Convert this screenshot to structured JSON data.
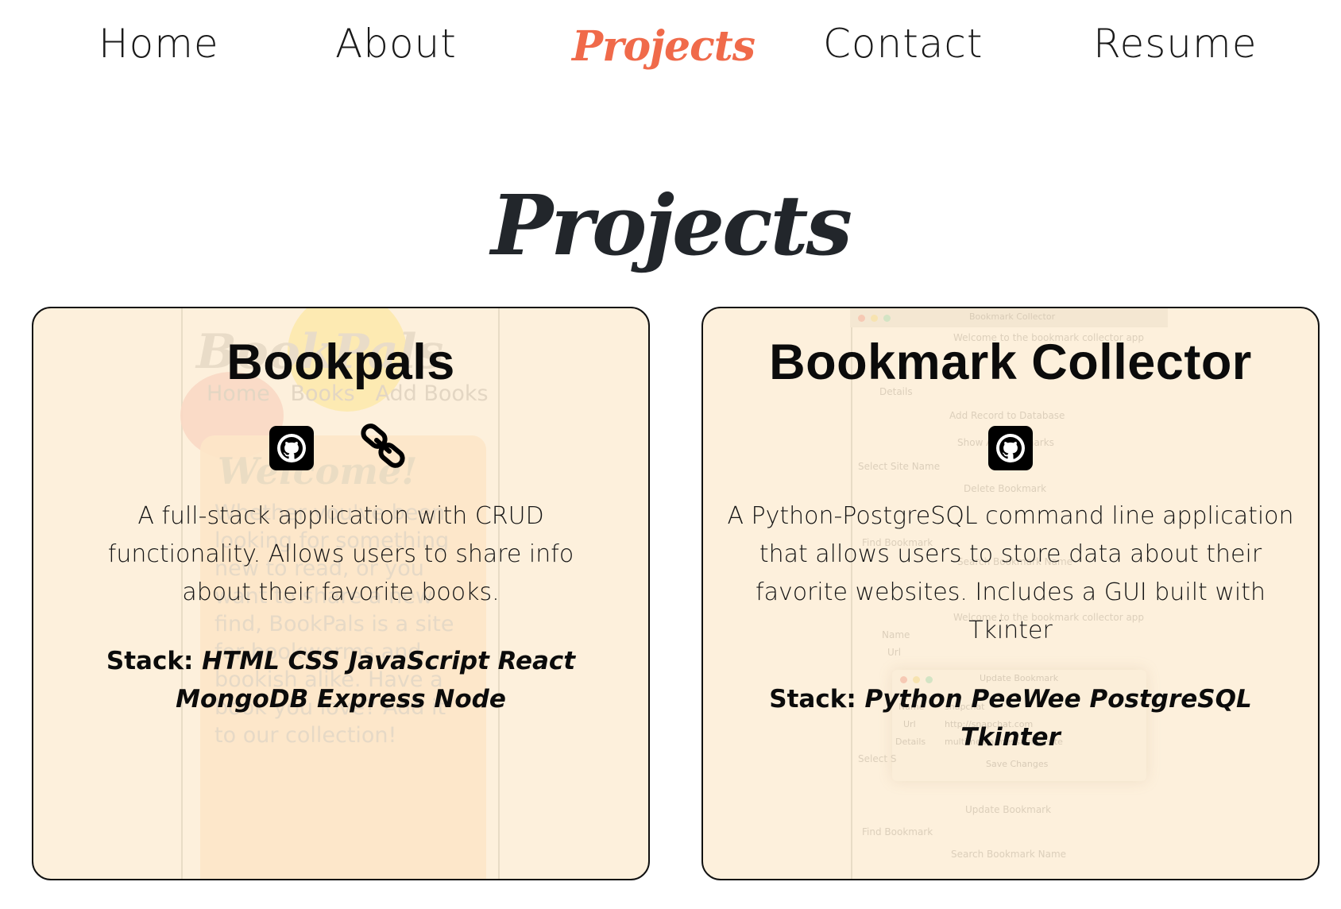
{
  "nav": {
    "items": [
      "Home",
      "About",
      "Projects",
      "Contact",
      "Resume"
    ],
    "active": "Projects",
    "active_color": "#f06a4a"
  },
  "page_title": "Projects",
  "projects": [
    {
      "title": "Bookpals",
      "links": [
        "github-icon",
        "link-icon"
      ],
      "description": "A full-stack application with CRUD functionality. Allows users to share info about their favorite books.",
      "stack_label": "Stack:",
      "stack": "HTML CSS JavaScript React MongoDB Express Node",
      "background_text": {
        "logo": "BookPals",
        "nav": "Home   Books   Add Books",
        "welcome": "Welcome!",
        "body": "Whether you've been looking for something new to read, or you want to share a new find, BookPals is a site for bookworms and bookish alike. Have a book you love? Add it to our collection!"
      }
    },
    {
      "title": "Bookmark Collector",
      "links": [
        "github-icon"
      ],
      "description": "A Python-PostgreSQL command line application that allows users to store data about their favorite websites. Includes a GUI built with Tkinter",
      "stack_label": "Stack:",
      "stack": "Python PeeWee PostgreSQL Tkinter",
      "background_text": {
        "window_title": "Bookmark Collector",
        "welcome": "Welcome to the bookmark collector app",
        "details": "Details",
        "add": "Add Record to Database",
        "show": "Show All Bookmarks",
        "select": "Select Site Name",
        "delete": "Delete Bookmark",
        "find": "Find Bookmark",
        "search": "Search Bookmark Name",
        "welcome2": "Welcome to the bookmark collector app",
        "name": "Name",
        "url": "Url",
        "update": "Update Bookmark",
        "name_value": "snapchat",
        "url_value": "http://snapchat.com",
        "details_value": "multimedia messaging site",
        "save": "Save Changes",
        "update2": "Update Bookmark",
        "find2": "Find Bookmark",
        "search2": "Search Bookmark Name",
        "select2": "Select S",
        "details2": "Details"
      }
    }
  ],
  "colors": {
    "card_bg": "#fdf0dc",
    "text": "#111111",
    "title": "#22262b"
  }
}
